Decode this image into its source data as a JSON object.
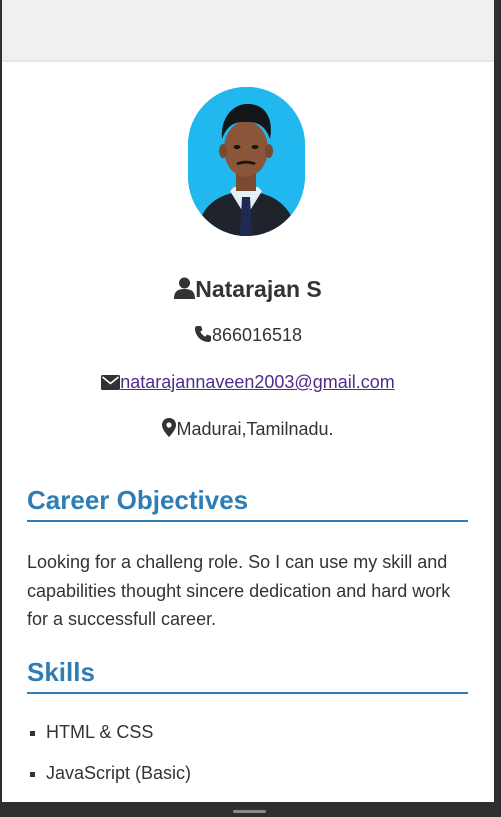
{
  "profile": {
    "name": "Natarajan S",
    "phone": "866016518",
    "email": "natarajannaveen2003@gmail.com",
    "location": "Madurai,Tamilnadu."
  },
  "sections": {
    "career": {
      "title": "Career Objectives",
      "text": "Looking for a challeng role. So I can use my skill and capabilities thought sincere dedication and hard work for a successfull career."
    },
    "skills": {
      "title": "Skills",
      "items": [
        "HTML & CSS",
        "JavaScript (Basic)"
      ]
    }
  },
  "colors": {
    "accent": "#2e7db4",
    "link": "#4f2c8c",
    "photo_background": "#21b8ef",
    "text": "#333333"
  },
  "icons": {
    "name": "user-icon",
    "phone": "phone-icon",
    "email": "envelope-icon",
    "location": "map-marker-icon"
  }
}
